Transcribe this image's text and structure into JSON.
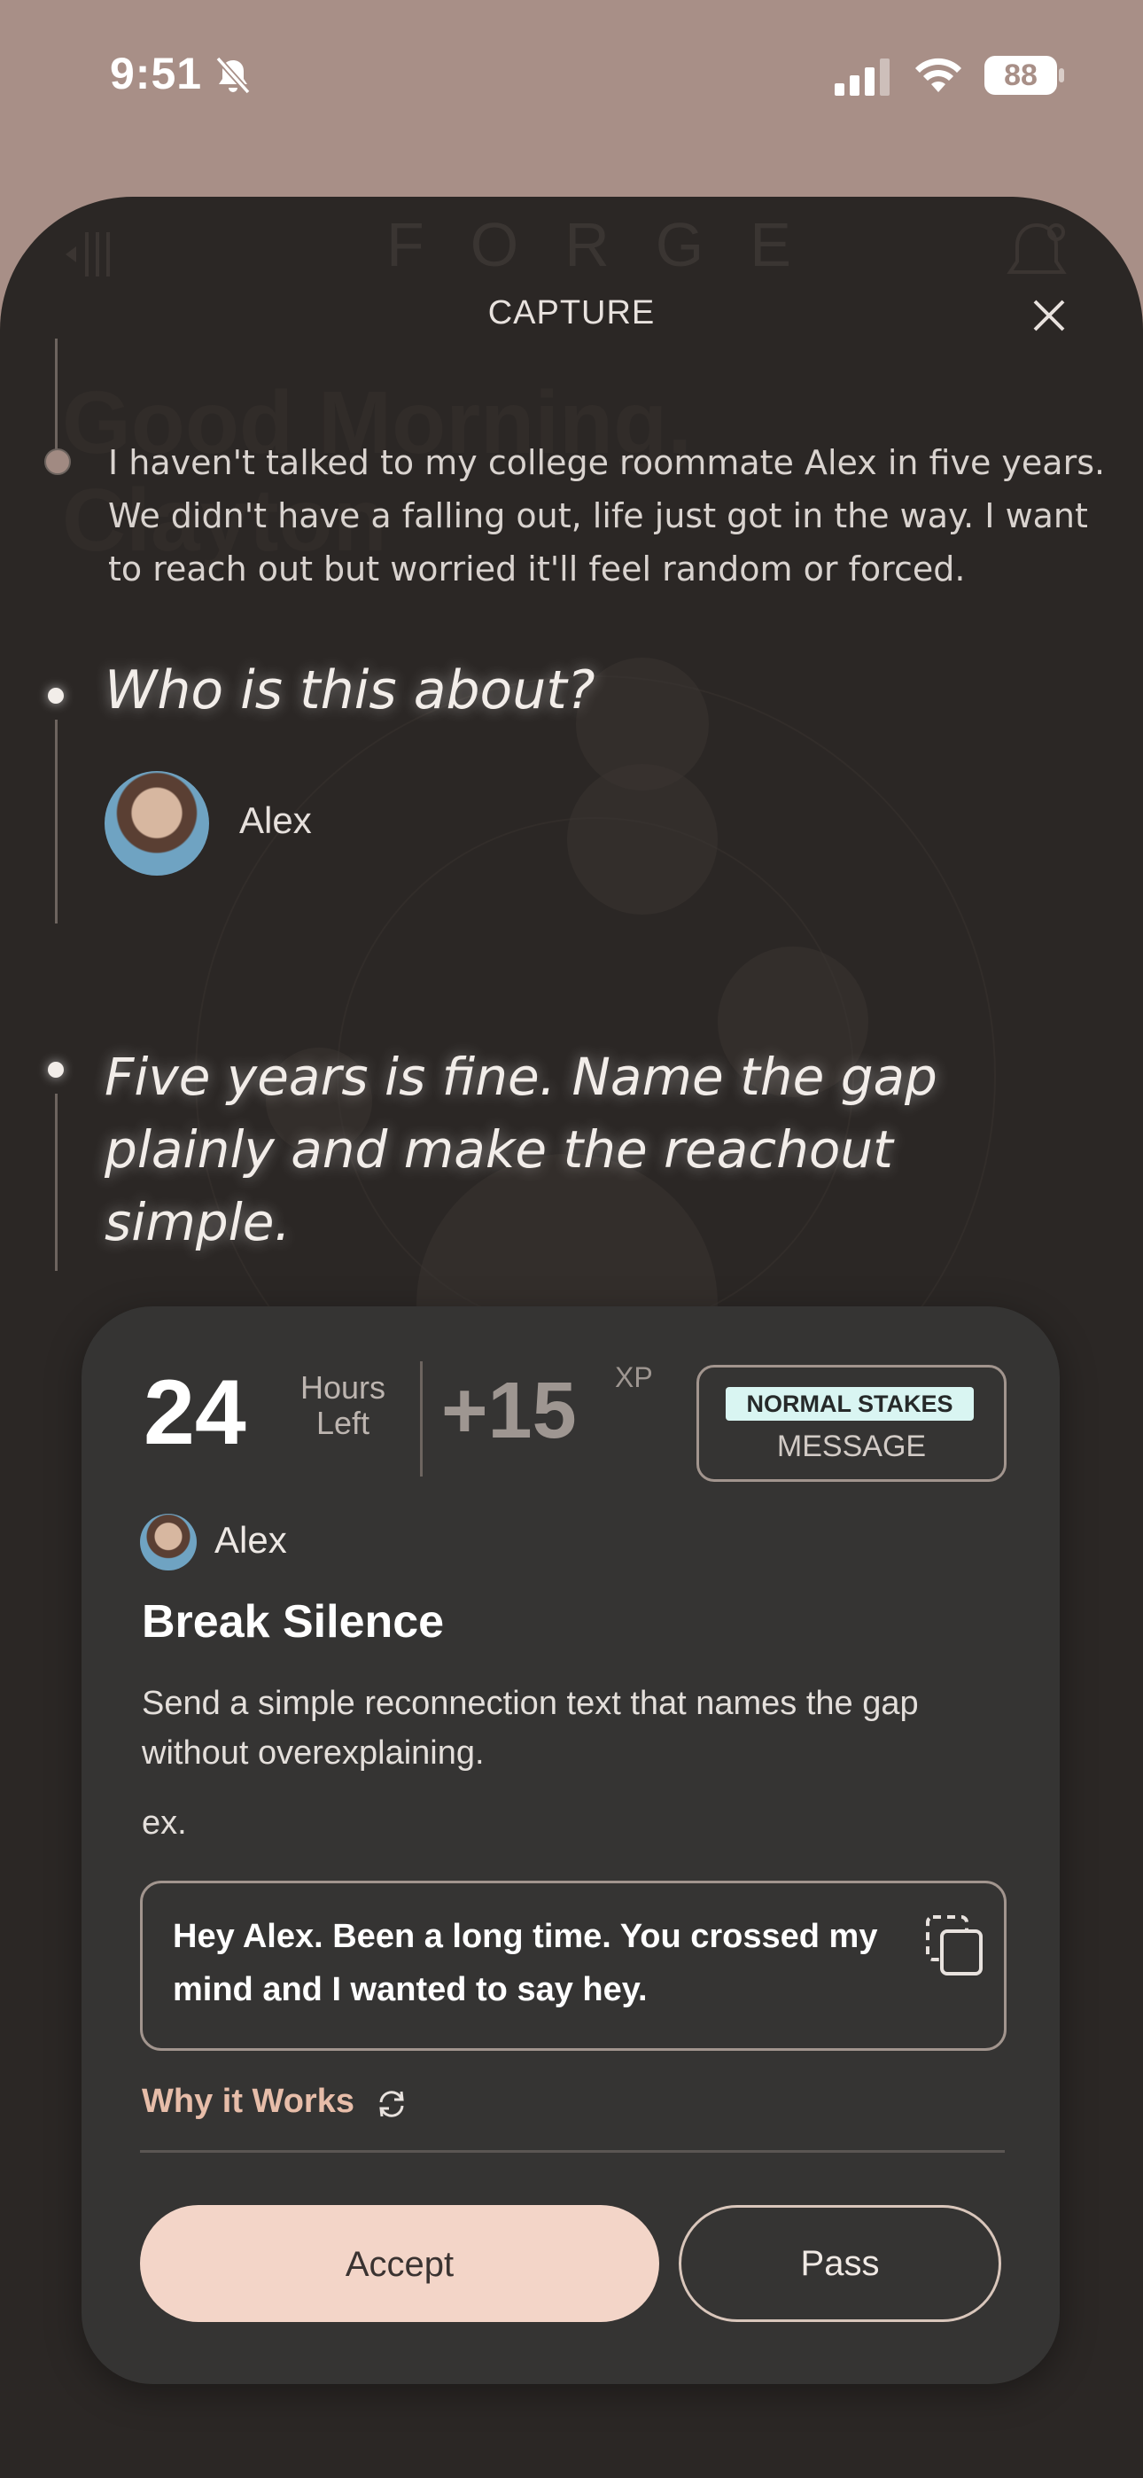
{
  "status_bar": {
    "time": "9:51",
    "battery": "88"
  },
  "background": {
    "logo": "FORGE",
    "greeting": "Good Morning, Clayton"
  },
  "sheet": {
    "title": "CAPTURE",
    "entry_text": "I haven't talked to my college roommate Alex in five years. We didn't have a falling out, life just got in the way. I want to reach out but worried it'll feel random or forced.",
    "question": "Who is this about?",
    "person_name": "Alex",
    "advice": "Five years is fine. Name the gap plainly and make the reachout simple."
  },
  "card": {
    "hours_value": "24",
    "hours_label_1": "Hours",
    "hours_label_2": "Left",
    "xp_value": "+15",
    "xp_label": "XP",
    "stakes_badge": "NORMAL STAKES",
    "stakes_type": "MESSAGE",
    "person_name": "Alex",
    "title": "Break Silence",
    "description": "Send a simple reconnection text that names the gap without overexplaining.",
    "ex_label": "ex.",
    "example_text": "Hey Alex. Been a long time. You crossed my mind and I wanted to say hey.",
    "why_label": "Why it Works",
    "accept_label": "Accept",
    "pass_label": "Pass"
  },
  "colors": {
    "accent": "#f3d5c8",
    "link": "#e7bda9",
    "badge_bg": "#d9f5f2",
    "sheet_bg": "#2b2725",
    "card_bg": "#353433",
    "top_bg": "#a88f87"
  }
}
